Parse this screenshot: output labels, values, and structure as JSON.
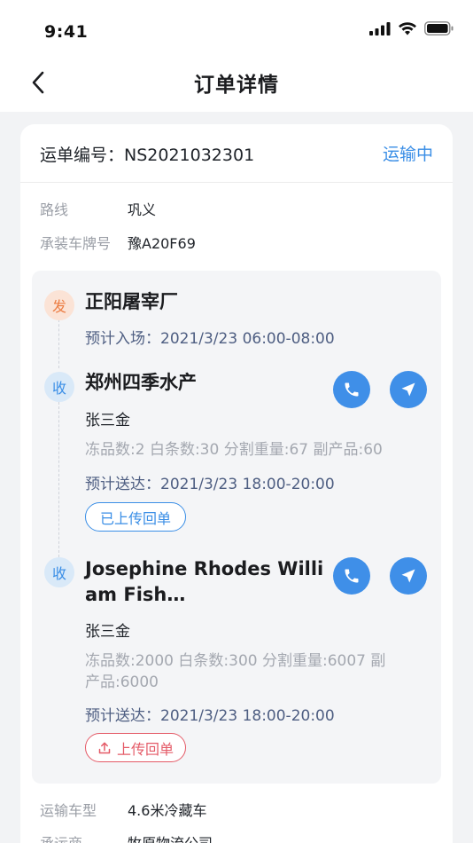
{
  "status_bar": {
    "time": "9:41"
  },
  "nav": {
    "title": "订单详情"
  },
  "order": {
    "label": "运单编号：NS2021032301",
    "status": "运输中",
    "status_color": "#3a8ee6"
  },
  "info": {
    "route_label": "路线",
    "route_value": "巩义",
    "plate_label": "承装车牌号",
    "plate_value": "豫A20F69",
    "vehicle_type_label": "运输车型",
    "vehicle_type_value": "4.6米冷藏车",
    "carrier_label": "承运商",
    "carrier_value": "牧原物流公司"
  },
  "stops": [
    {
      "badge": "发",
      "name": "正阳屠宰厂",
      "eta": "预计入场：2021/3/23 06:00-08:00"
    },
    {
      "badge": "收",
      "name": "郑州四季水产",
      "contact": "张三金",
      "stats": "冻品数:2  白条数:30  分割重量:67  副产品:60",
      "eta": "预计送达：2021/3/23 18:00-20:00",
      "receipt": "已上传回单"
    },
    {
      "badge": "收",
      "name_line1": "Josephine Rhodes Willi",
      "name_line2": "am Fish…",
      "contact": "张三金",
      "stats_line1": "冻品数:2000  白条数:300  分割重量:6007  副",
      "stats_line2": "产品:6000",
      "eta": "预计送达：2021/3/23 18:00-20:00",
      "receipt": "上传回单"
    }
  ],
  "icons": [
    "back-icon",
    "phone-icon",
    "navigate-icon",
    "upload-icon",
    "signal-icon",
    "wifi-icon",
    "battery-icon"
  ]
}
